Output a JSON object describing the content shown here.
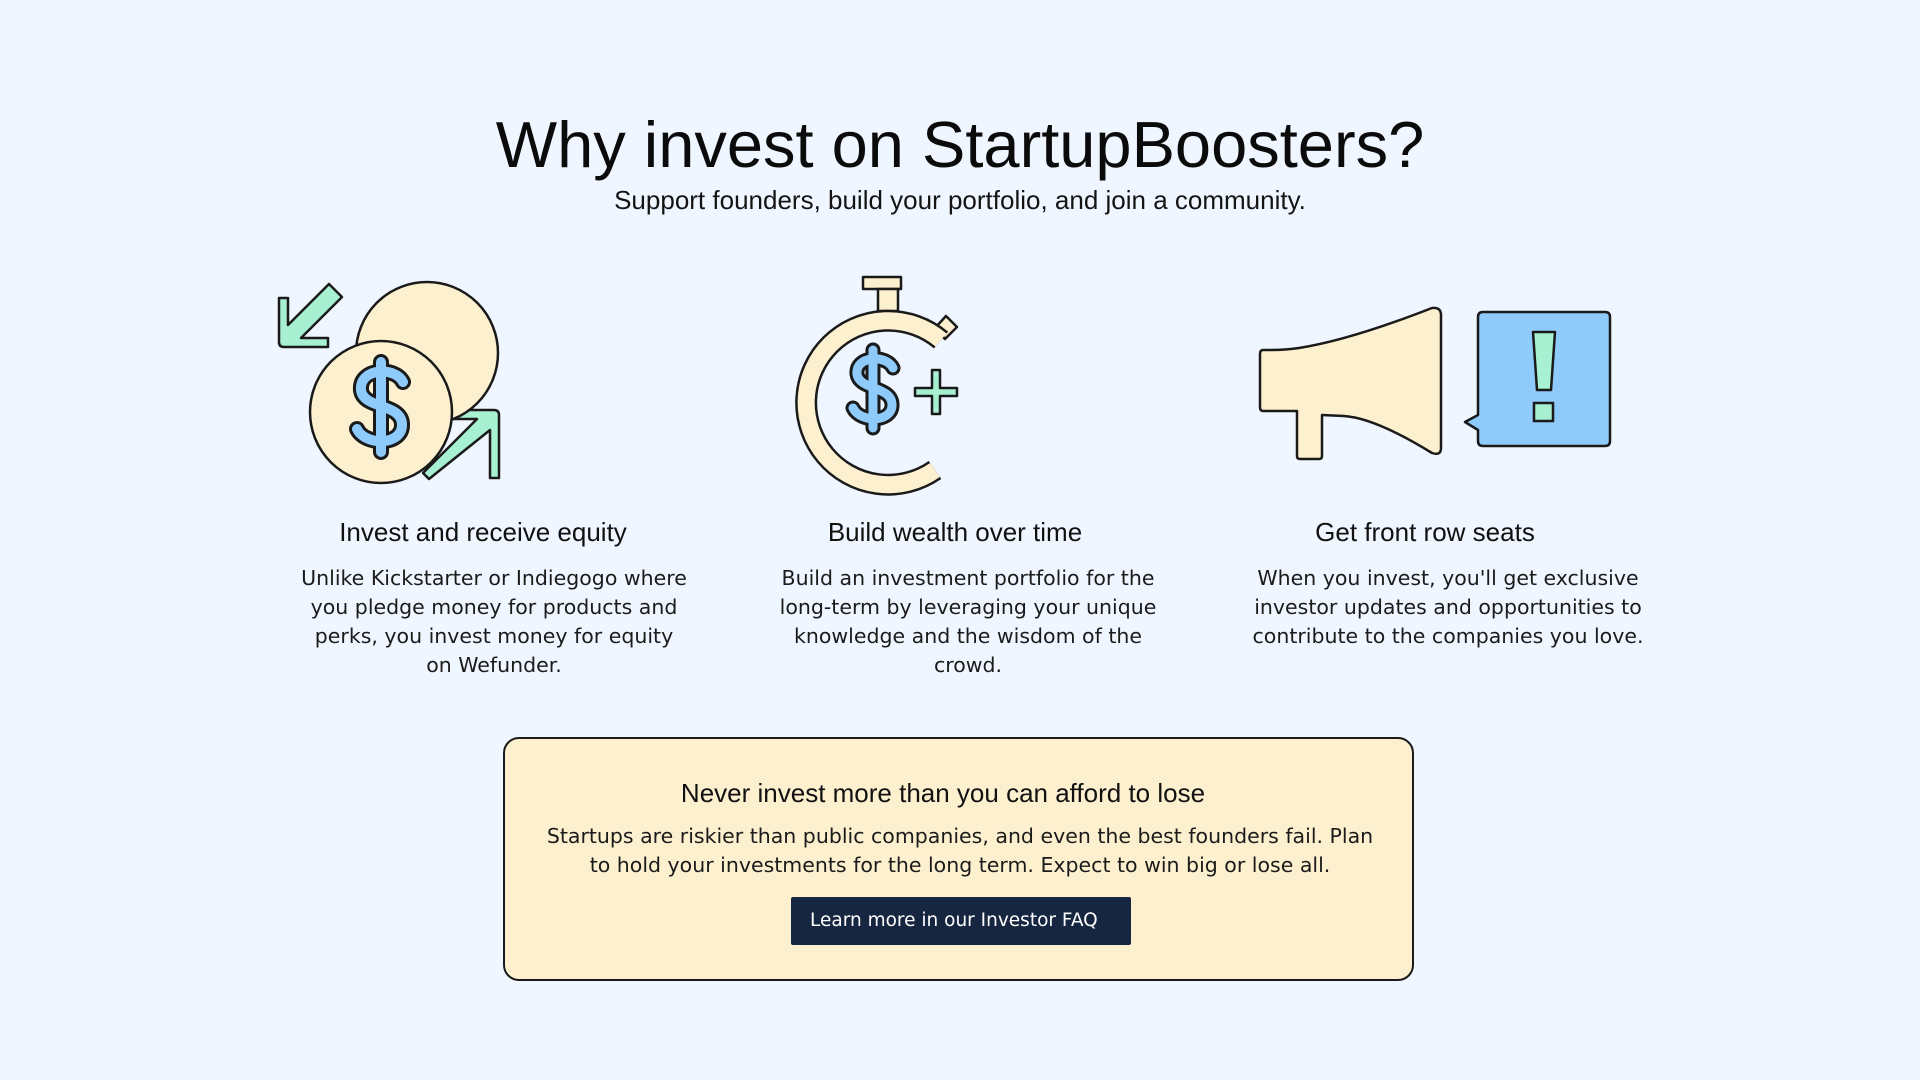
{
  "header": {
    "title": "Why invest on StartupBoosters?",
    "subtitle": "Support founders, build your portfolio, and join a community."
  },
  "features": [
    {
      "icon": "coins-exchange-icon",
      "title": "Invest and receive equity",
      "description": "Unlike Kickstarter or Indiegogo where you pledge money for products and perks, you invest money for equity on Wefunder."
    },
    {
      "icon": "stopwatch-dollar-icon",
      "title": "Build wealth over time",
      "description": "Build an investment portfolio for the long-term by leveraging your unique knowledge and the wisdom of the crowd."
    },
    {
      "icon": "megaphone-alert-icon",
      "title": "Get front row seats",
      "description": "When you invest, you'll get exclusive investor updates and opportunities to contribute to the companies you love."
    }
  ],
  "warning": {
    "title": "Never invest more than you can afford to lose",
    "text": "Startups are riskier than public companies, and even the best founders fail. Plan to hold your investments for the long term. Expect to win big or lose all.",
    "button_label": "Learn more in our Investor FAQ"
  },
  "colors": {
    "background": "#eff6ff",
    "cream": "#fdf0cf",
    "blue": "#8ecbfb",
    "mint": "#a7f0d2",
    "button": "#172640"
  }
}
